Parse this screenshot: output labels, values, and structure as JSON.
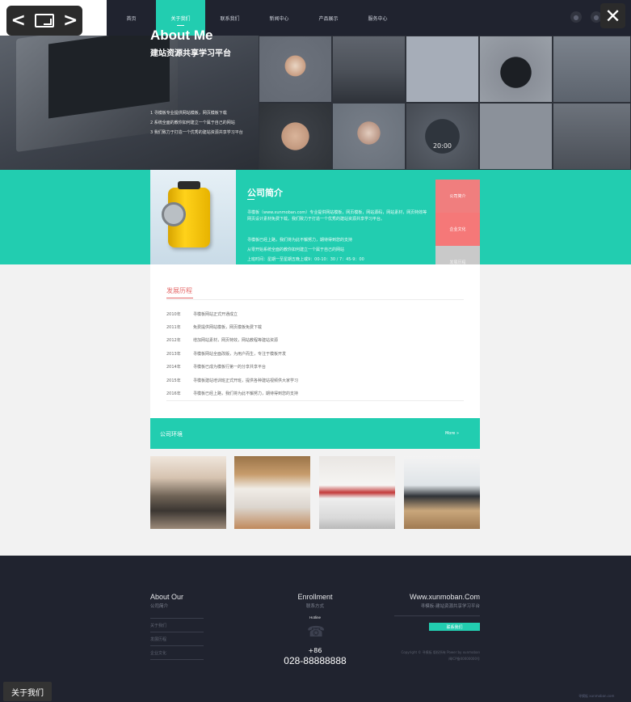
{
  "nav": {
    "items": [
      {
        "label": "首页"
      },
      {
        "label": "关于我们"
      },
      {
        "label": "联系我们"
      },
      {
        "label": "新闻中心"
      },
      {
        "label": "产品展示"
      },
      {
        "label": "服务中心"
      }
    ],
    "active_index": 1
  },
  "viewer": {
    "prev": "<",
    "next": ">",
    "close": "✕",
    "caption": "关于我们"
  },
  "banner": {
    "title": "About Me",
    "subtitle": "建站资源共享学习平台",
    "lines": [
      "1 寻模板专业提供网站模板，网页模板下载",
      "2 系统全面的教你如何建立一个属于自己的网站",
      "3 我们致力于打造一个优秀的建站资源共享学习平台"
    ],
    "watch_time": "20:00"
  },
  "about": {
    "title": "公司简介",
    "paragraphs": [
      "寻模板（www.xunmoban.com）专业提供网站模板，网页模板，网站源码，网站素材，网页特效等网页设计素材免费下载。我们致力于打造一个优秀的建站资源共享学习平台。",
      "寻模板已经上路，我们将为此不懈努力，期待得到您的支持",
      "从零开始系统全面的教你如何建立一个属于自己的网站",
      "上班时间：星期一至星期五晚上或9：00-10：30 / 7：45-9：00"
    ],
    "tabs": [
      "公司简介",
      "企业文化",
      "发展历程"
    ]
  },
  "history": {
    "title": "发展历程",
    "rows": [
      {
        "year": "2010年",
        "text": "寻模板网站正式开通成立"
      },
      {
        "year": "2011年",
        "text": "免费提供网站模板，网页模板免费下载"
      },
      {
        "year": "2012年",
        "text": "增加网站素材，网页特效，网站教程等建站资源"
      },
      {
        "year": "2013年",
        "text": "寻模板网站全面改版，为用户而生，专注于模板开发"
      },
      {
        "year": "2014年",
        "text": "寻模板已成为模板行第一的分享共享平台"
      },
      {
        "year": "2015年",
        "text": "寻模板建站培训班正式开班，提供各种建站视频供大家学习"
      },
      {
        "year": "2016年",
        "text": "寻模板已经上路，我们将为此不懈努力，期待得到您的支持"
      }
    ]
  },
  "environment": {
    "title": "公司环境",
    "more": "More »"
  },
  "footer": {
    "col1": {
      "title": "About Our",
      "subtitle": "公司简介",
      "links": [
        "关于我们",
        "发展历程",
        "企业文化"
      ]
    },
    "col2": {
      "title": "Enrollment",
      "subtitle": "联系方式",
      "hotline_label": "Hotline",
      "country_code": "+86",
      "phone": "028-88888888"
    },
    "col3": {
      "title": "Www.xunmoban.Com",
      "subtitle": "寻模板-建站资源共享学习平台",
      "button": "联系我们",
      "copyright": "Copyright © 寻模板 版权所有 Power by xunmoban",
      "icp": "闽ICP备00000000号"
    },
    "watermark": "寻模板 xunmoban.com"
  },
  "colors": {
    "accent": "#22cdb0",
    "header_bg": "#20232f",
    "tab_red": "#f07e7e",
    "history_title": "#e46a6a"
  }
}
